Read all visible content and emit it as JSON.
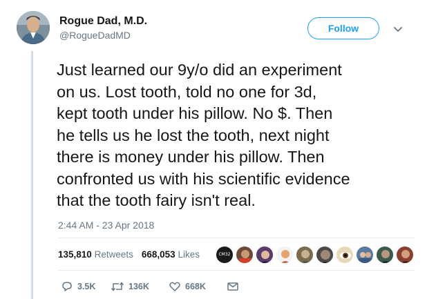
{
  "author": {
    "name": "Rogue Dad, M.D.",
    "handle": "@RogueDadMD"
  },
  "follow_label": "Follow",
  "tweet_text": "Just learned our 9y/o did an experiment\non us.  Lost tooth, told no one for 3d,\nkept tooth under his pillow.  No $.  Then\nhe tells us he lost the tooth, next night\nthere is money under his pillow.  Then\nconfronted us with his scientific evidence\nthat the tooth fairy isn't real.",
  "timestamp": "2:44 AM - 23 Apr 2018",
  "stats": {
    "retweets_count": "135,810",
    "retweets_label": "Retweets",
    "likes_count": "668,053",
    "likes_label": "Likes"
  },
  "liker_badge_text": "CM32",
  "actions": {
    "replies": "3.5K",
    "retweets": "136K",
    "likes": "668K"
  },
  "colors": {
    "accent": "#1da1f2",
    "secondary_text": "#657786",
    "primary_text": "#14171a",
    "thread_line": "#d3dce5"
  },
  "icons": [
    "chevron-down-icon",
    "reply-icon",
    "retweet-icon",
    "heart-icon",
    "envelope-icon"
  ]
}
